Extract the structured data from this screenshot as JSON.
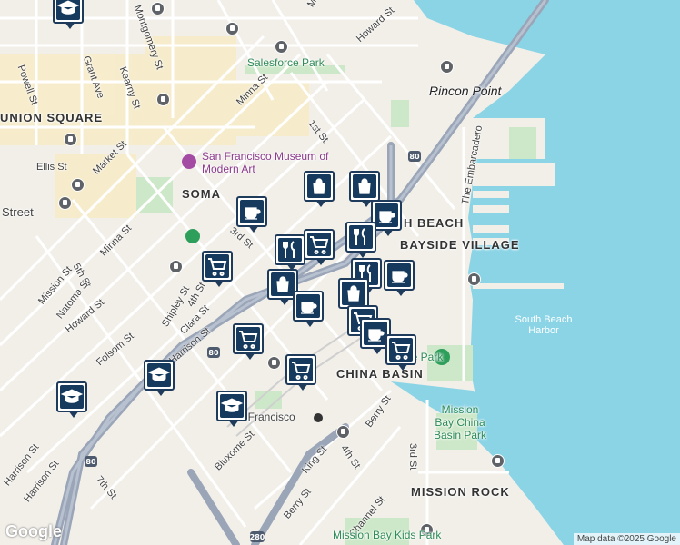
{
  "map": {
    "streets": [
      "Mission St",
      "Howard St",
      "Montgomery St",
      "Kearny St",
      "Grant Ave",
      "Powell St",
      "Minna St",
      "1st St",
      "Market St",
      "Ellis St",
      "Street",
      "Minna St",
      "5th St",
      "Natoma St",
      "Mission St",
      "Howard St",
      "Folsom St",
      "Harrison St",
      "Shipley St",
      "4th St",
      "Clara St",
      "Harrison St",
      "3rd St",
      "Bluxome St",
      "Berry St",
      "King St",
      "4th St",
      "Channel St",
      "Berry St",
      "3rd St",
      "Harrison St",
      "7th St",
      "The Embarcadero",
      "Harrison St",
      "Minna St"
    ],
    "neighborhoods": [
      "UNION SQUARE",
      "SOMA",
      "BAYSIDE VILLAGE",
      "CHINA BASIN",
      "MISSION ROCK",
      "H BEACH"
    ],
    "parks": [
      "Salesforce Park",
      "Mission Bay China Basin Park",
      "Oracle Park",
      "Mission Bay Kids Park"
    ],
    "water": [
      "South Beach Harbor"
    ],
    "places": [
      "Rincon Point"
    ],
    "poi": [
      "San Francisco Museum of Modern Art",
      "San Francisco"
    ],
    "highways": [
      "80",
      "80",
      "80",
      "280"
    ],
    "pins": [
      {
        "type": "shopping-bag"
      },
      {
        "type": "shopping-bag"
      },
      {
        "type": "coffee"
      },
      {
        "type": "coffee"
      },
      {
        "type": "restaurant"
      },
      {
        "type": "restaurant"
      },
      {
        "type": "shopping-cart"
      },
      {
        "type": "shopping-cart"
      },
      {
        "type": "restaurant"
      },
      {
        "type": "shopping-bag"
      },
      {
        "type": "coffee"
      },
      {
        "type": "coffee"
      },
      {
        "type": "shopping-bag"
      },
      {
        "type": "shopping-cart"
      },
      {
        "type": "coffee"
      },
      {
        "type": "shopping-cart"
      },
      {
        "type": "shopping-cart"
      },
      {
        "type": "shopping-cart"
      },
      {
        "type": "school"
      },
      {
        "type": "school"
      },
      {
        "type": "school"
      },
      {
        "type": "school"
      }
    ],
    "attribution": "Map data ©2025 Google",
    "logo": "Google"
  }
}
